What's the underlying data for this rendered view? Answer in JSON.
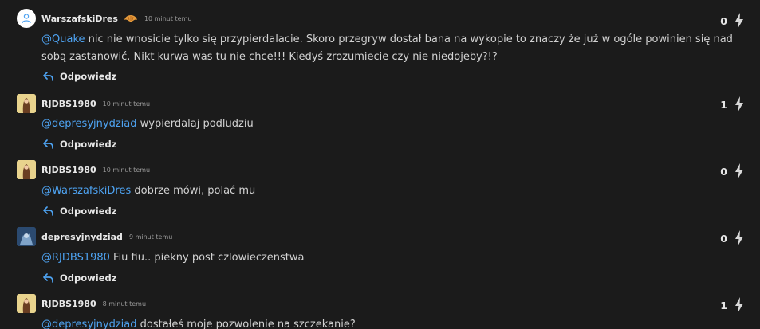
{
  "comments": [
    {
      "author": "WarszafskiDres",
      "badge_icon": "croissant-icon",
      "time": "10 minut temu",
      "avatar": "default",
      "mention": "@Quake",
      "text": " nic nie wnosicie tylko się przypierdalacie. Skoro przegryw dostał bana na wykopie to znaczy że już w ogóle powinien się nad sobą zastanowić. Nikt kurwa was tu nie chce!!! Kiedyś zrozumiecie czy nie niedojeby?!?",
      "reply_label": "Odpowiedz",
      "votes": "0"
    },
    {
      "author": "RJDBS1980",
      "time": "10 minut temu",
      "avatar": "photo",
      "mention": "@depresyjnydziad",
      "text": " wypierdalaj podludziu",
      "reply_label": "Odpowiedz",
      "votes": "1"
    },
    {
      "author": "RJDBS1980",
      "time": "10 minut temu",
      "avatar": "photo",
      "mention": "@WarszafskiDres",
      "text": " dobrze mówi, polać mu",
      "reply_label": "Odpowiedz",
      "votes": "0"
    },
    {
      "author": "depresyjnydziad",
      "time": "9 minut temu",
      "avatar": "blue",
      "mention": "@RJDBS1980",
      "text": " Fiu fiu.. piekny post czlowieczenstwa",
      "reply_label": "Odpowiedz",
      "votes": "0"
    },
    {
      "author": "RJDBS1980",
      "time": "8 minut temu",
      "avatar": "photo",
      "mention": "@depresyjnydziad",
      "text": " dostałeś moje pozwolenie na szczekanie?",
      "reply_label": "Odpowiedz",
      "votes": "1"
    }
  ],
  "colors": {
    "mention": "#4ea3f2",
    "reply_icon": "#4ea3f2",
    "background": "#1b1b1b"
  },
  "icons": {
    "reply": "reply-arrow-icon",
    "vote": "lightning-bolt-icon",
    "default_avatar": "user-icon"
  }
}
